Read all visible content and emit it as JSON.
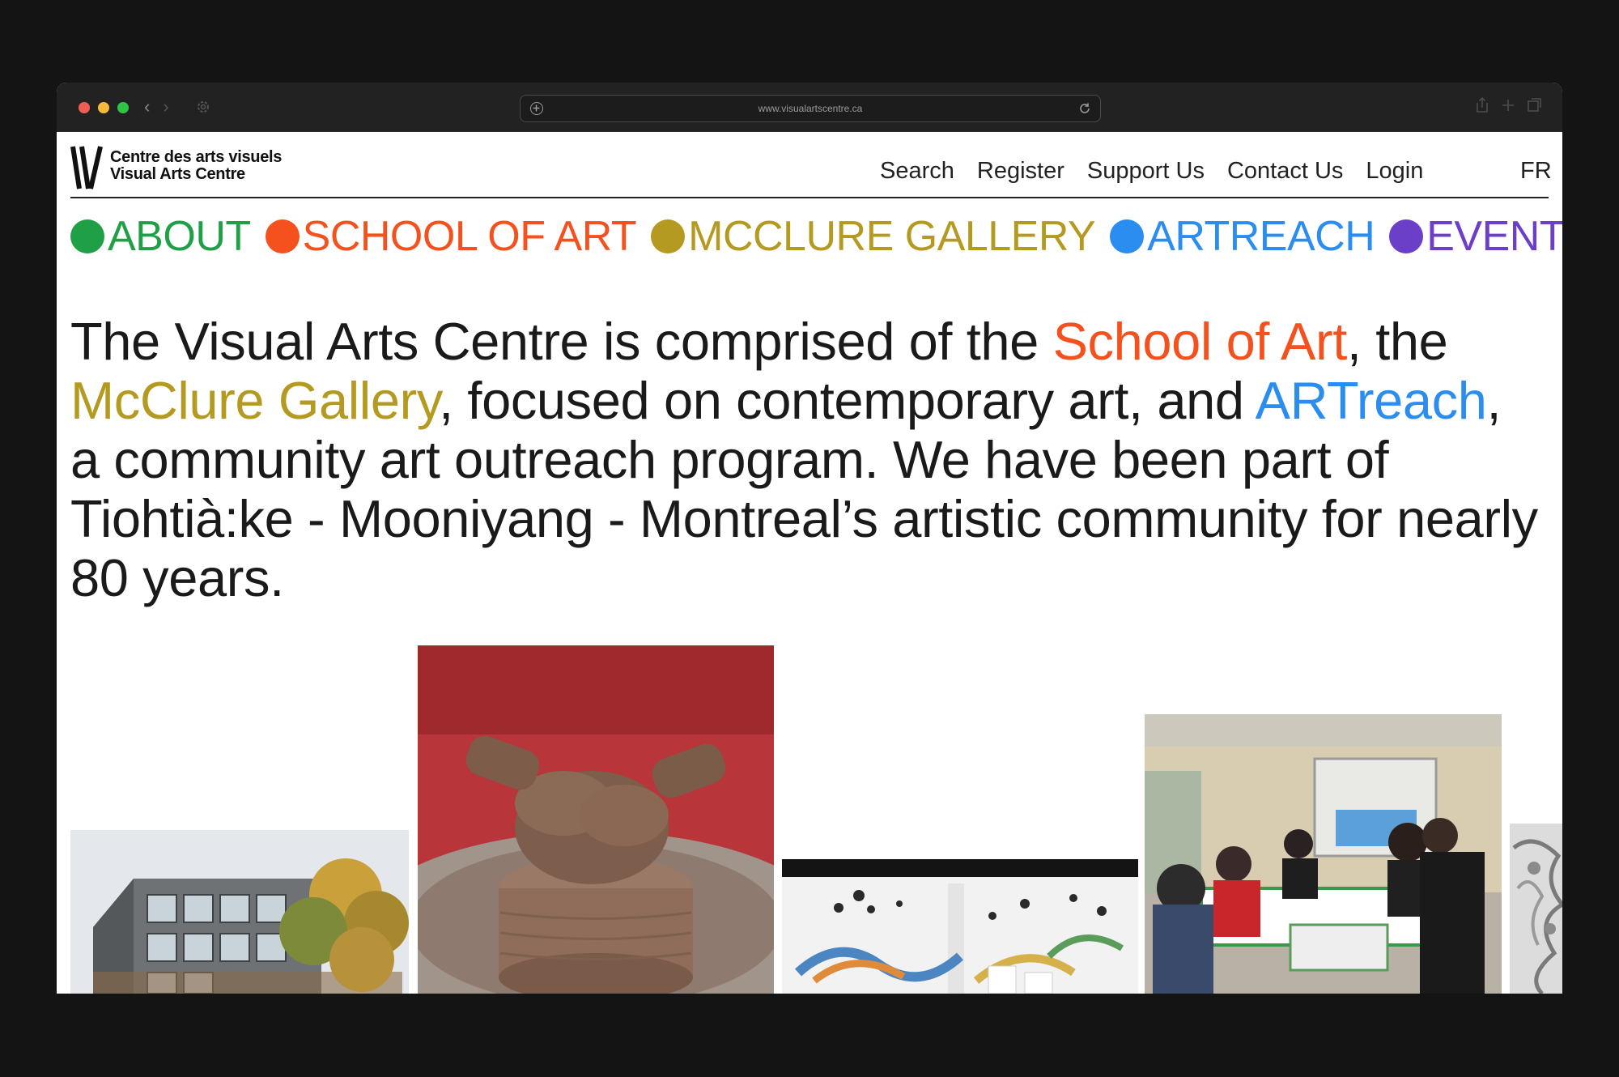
{
  "browser": {
    "url": "www.visualartscentre.ca",
    "traffic_light_colors": [
      "#ee5e55",
      "#f5bc3a",
      "#31c548"
    ],
    "icons": [
      "back-icon",
      "forward-icon",
      "settings-icon",
      "new-tab-icon",
      "reload-icon",
      "share-icon",
      "add-tab-icon",
      "tabs-overview-icon"
    ]
  },
  "header": {
    "logo_line1": "Centre des arts visuels",
    "logo_line2": "Visual Arts Centre",
    "utility_links": [
      {
        "label": "Search"
      },
      {
        "label": "Register"
      },
      {
        "label": "Support Us"
      },
      {
        "label": "Contact Us"
      },
      {
        "label": "Login"
      }
    ],
    "language_toggle": "FR"
  },
  "main_nav": [
    {
      "label": "ABOUT",
      "color": "#1fa046"
    },
    {
      "label": "SCHOOL OF ART",
      "color": "#f4511e"
    },
    {
      "label": "MCCLURE GALLERY",
      "color": "#b49a21"
    },
    {
      "label": "ARTREACH",
      "color": "#2b8df0"
    },
    {
      "label": "EVENTS",
      "color": "#6c3fc9"
    }
  ],
  "intro": {
    "part1": "The Visual Arts Centre is comprised of the ",
    "link_school": "School of Art",
    "part2": ", the ",
    "link_gallery": "McClure Gallery",
    "part3": ", focused on contemporary art, and ",
    "link_artreach": "ARTreach",
    "part4": ", a community art outreach program. We have been part of Tiohtià:ke - Mooniyang - Montreal’s artistic community for nearly 80 years."
  },
  "colors": {
    "school": "#f4511e",
    "gallery": "#b49a21",
    "artreach": "#2b8df0",
    "text": "#1a1a1a",
    "backdrop": "#141414"
  }
}
